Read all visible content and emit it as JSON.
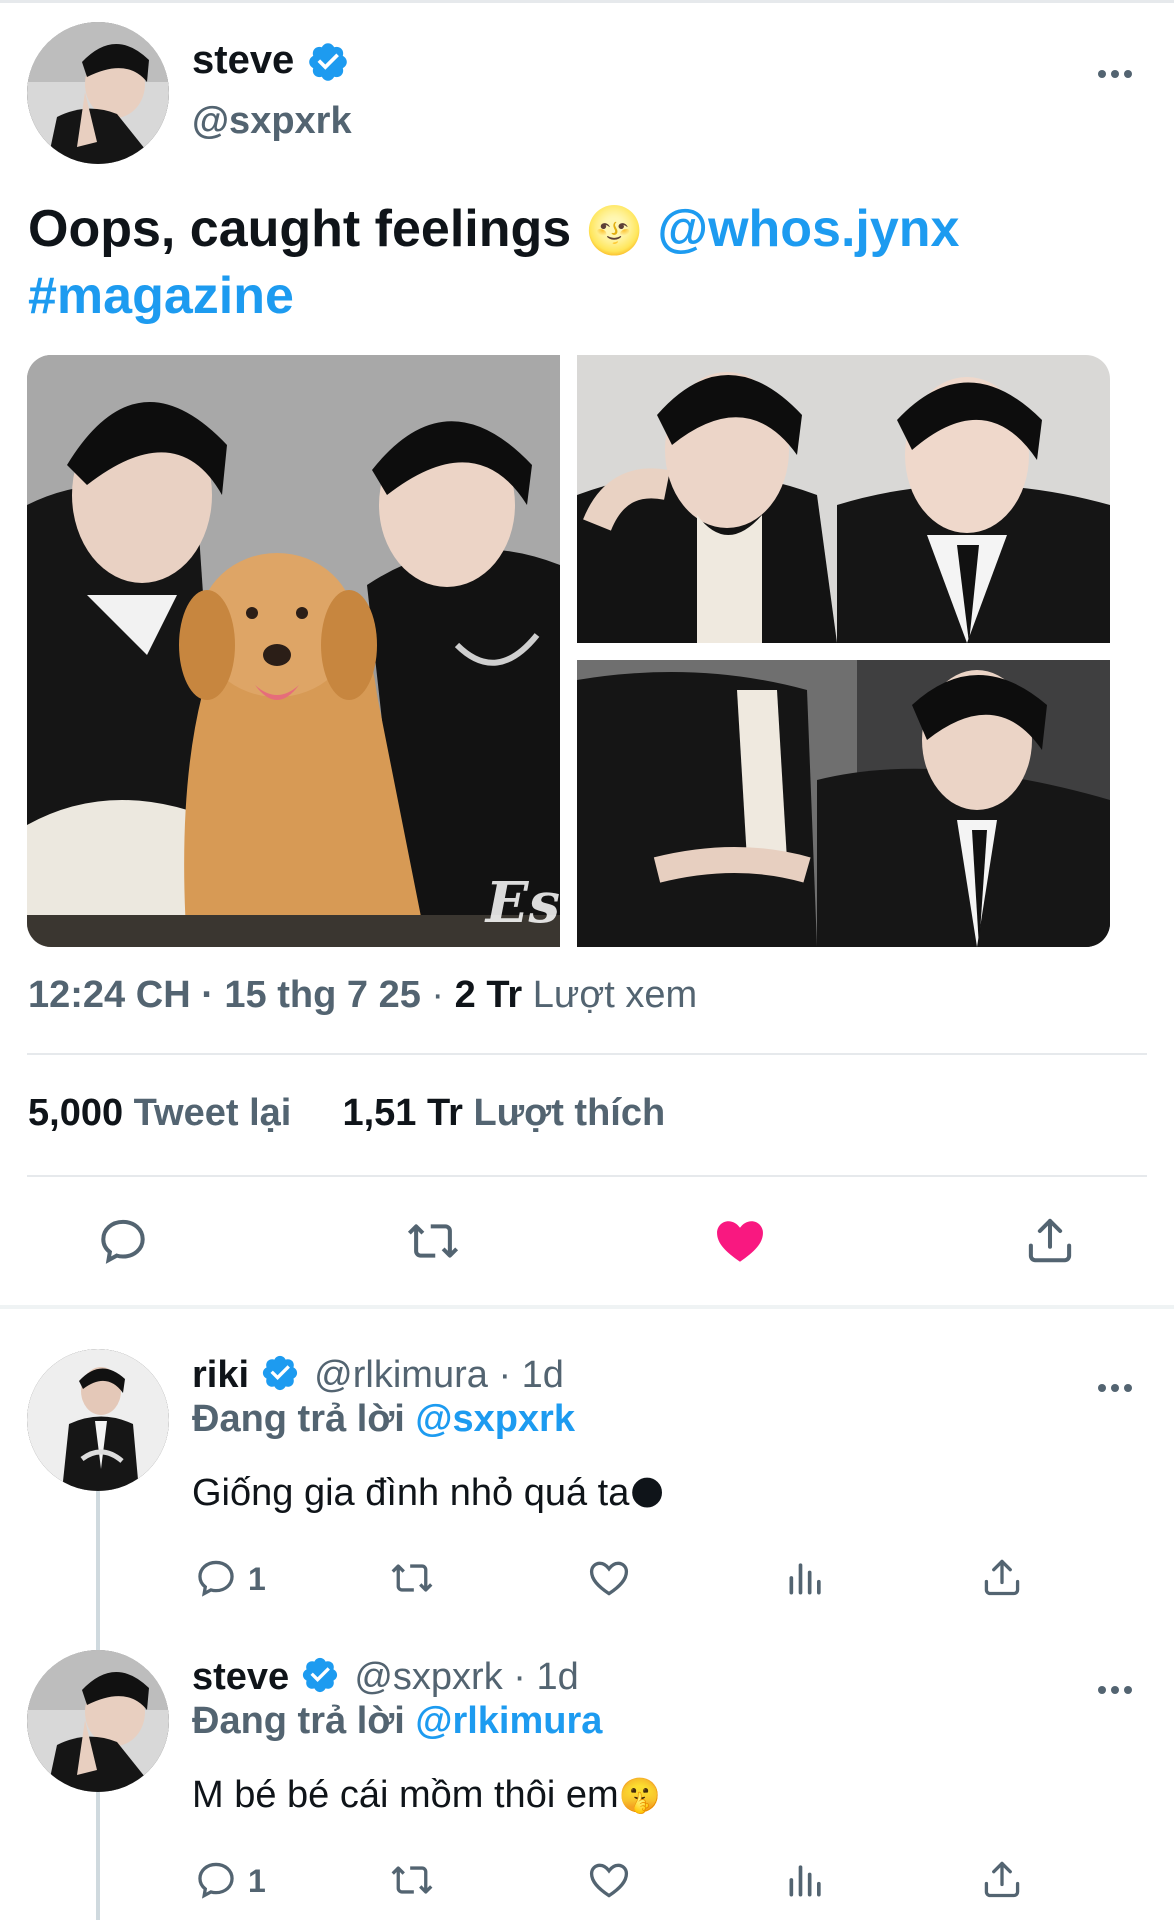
{
  "tweet": {
    "author": {
      "name": "steve",
      "handle": "@sxpxrk",
      "verified": true
    },
    "text": "Oops, caught feelings",
    "emoji_moon": "🌝",
    "mention": "@whos.jynx",
    "hashtag": "#magazine",
    "image_watermark": "Es",
    "time": "12:24 CH",
    "date": "15 thg 7 25",
    "views_count": "2 Tr",
    "views_label": "Lượt xem",
    "retweets_count": "5,000",
    "retweets_label": "Tweet lại",
    "likes_count": "1,51 Tr",
    "likes_label": "Lượt thích",
    "liked": true
  },
  "replies": [
    {
      "name": "riki",
      "handle": "@rlkimura",
      "age": "1d",
      "replying_label": "Đang trả lời",
      "replying_to": "@sxpxrk",
      "text": "Giống gia đình nhỏ quá ta",
      "emoji": "🌑",
      "reply_count": "1"
    },
    {
      "name": "steve",
      "handle": "@sxpxrk",
      "age": "1d",
      "replying_label": "Đang trả lời",
      "replying_to": "@rlkimura",
      "text": "M bé bé cái mồm thôi em",
      "emoji": "🤫",
      "reply_count": "1"
    }
  ],
  "icons": {
    "more": "more-icon",
    "reply": "reply-icon",
    "retweet": "retweet-icon",
    "like": "heart-icon",
    "share": "share-icon",
    "views": "views-icon"
  },
  "colors": {
    "accent": "#1d9bf0",
    "like": "#f91880",
    "muted": "#536471"
  }
}
